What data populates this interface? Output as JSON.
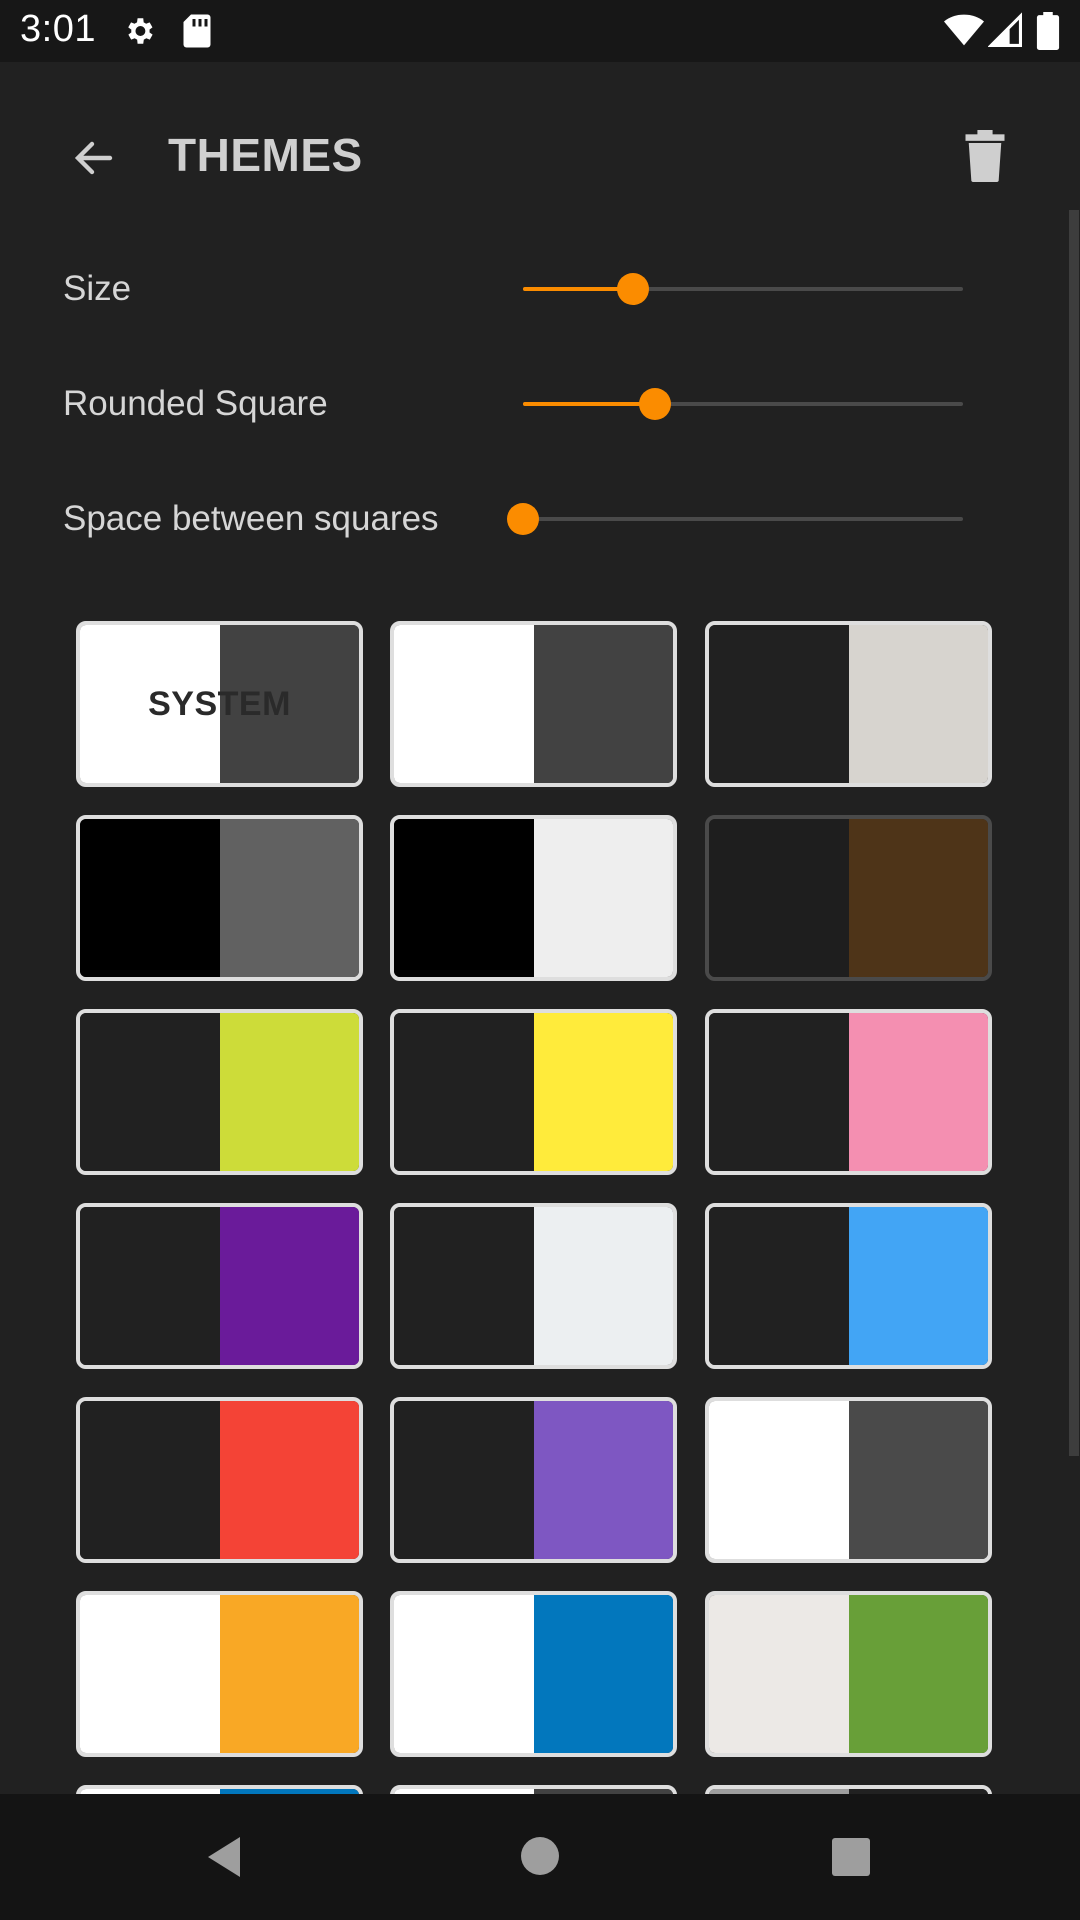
{
  "status_bar": {
    "time": "3:01",
    "icons": [
      "settings-icon",
      "sd-card-icon",
      "wifi-icon",
      "cell-signal-icon",
      "battery-icon"
    ]
  },
  "app_bar": {
    "title": "THEMES",
    "back_icon": "arrow-left-icon",
    "delete_icon": "trash-icon"
  },
  "sliders": [
    {
      "label": "Size",
      "value": 0.25
    },
    {
      "label": "Rounded Square",
      "value": 0.3
    },
    {
      "label": "Space between squares",
      "value": 0.0
    }
  ],
  "accent_color": "#fb8c00",
  "themes": [
    {
      "left": "#ffffff",
      "right": "#424242",
      "border": "#dedede",
      "label": "SYSTEM"
    },
    {
      "left": "#ffffff",
      "right": "#424242",
      "border": "#dedede"
    },
    {
      "left": "#212121",
      "right": "#d7d4cf",
      "border": "#dedede"
    },
    {
      "left": "#000000",
      "right": "#616161",
      "border": "#dedede"
    },
    {
      "left": "#000000",
      "right": "#eeeeee",
      "border": "#dedede"
    },
    {
      "left": "#1e1e1e",
      "right": "#4e3418",
      "border": "#4a4a4a"
    },
    {
      "left": "#212121",
      "right": "#cddc39",
      "border": "#dedede"
    },
    {
      "left": "#212121",
      "right": "#ffeb3b",
      "border": "#dedede"
    },
    {
      "left": "#212121",
      "right": "#f48fb1",
      "border": "#dedede"
    },
    {
      "left": "#212121",
      "right": "#6a1b9a",
      "border": "#dedede"
    },
    {
      "left": "#212121",
      "right": "#eceff1",
      "border": "#dedede"
    },
    {
      "left": "#212121",
      "right": "#42a5f5",
      "border": "#dedede"
    },
    {
      "left": "#212121",
      "right": "#f44336",
      "border": "#dedede"
    },
    {
      "left": "#212121",
      "right": "#7e57c2",
      "border": "#dedede"
    },
    {
      "left": "#ffffff",
      "right": "#4a4a4a",
      "border": "#dedede"
    },
    {
      "left": "#ffffff",
      "right": "#f9a825",
      "border": "#dedede"
    },
    {
      "left": "#ffffff",
      "right": "#0277bd",
      "border": "#dedede"
    },
    {
      "left": "#ece9e6",
      "right": "#689f38",
      "border": "#dedede"
    },
    {
      "left": "#ffffff",
      "right": "#0277bd",
      "border": "#dedede"
    },
    {
      "left": "#ffffff",
      "right": "#424242",
      "border": "#dedede"
    },
    {
      "left": "#9e9e9e",
      "right": "#212121",
      "border": "#dedede"
    }
  ],
  "nav_bar": {
    "icons": [
      "back-triangle-icon",
      "home-circle-icon",
      "recents-square-icon"
    ]
  }
}
